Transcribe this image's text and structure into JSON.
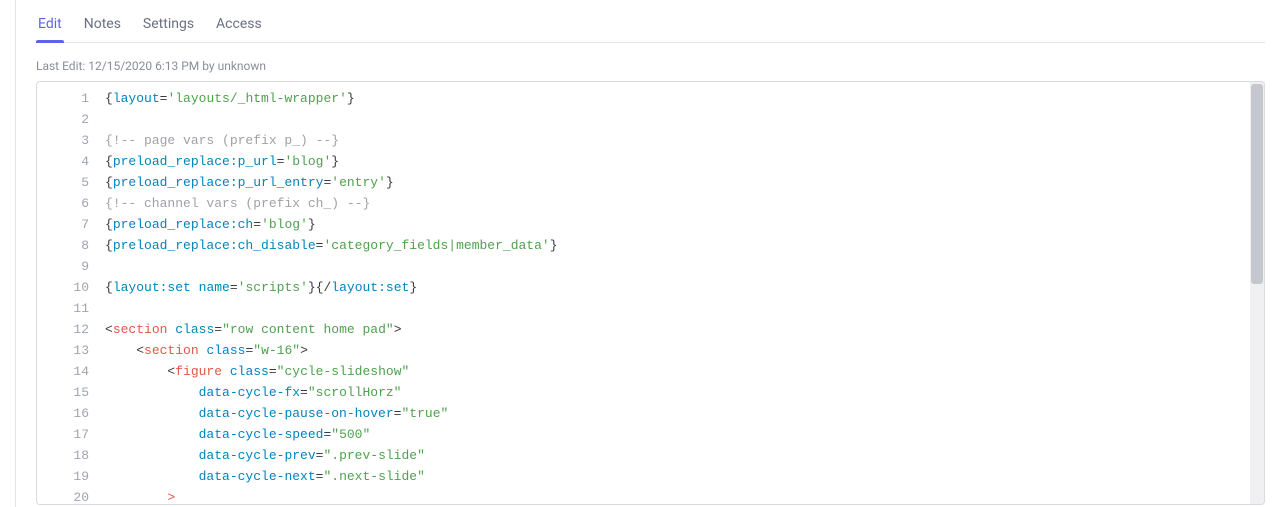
{
  "tabs": {
    "edit": "Edit",
    "notes": "Notes",
    "settings": "Settings",
    "access": "Access"
  },
  "meta": {
    "last_edit_label": "Last Edit: 12/15/2020 6:13 PM by unknown"
  },
  "editor": {
    "line_count": 20,
    "code_lines": [
      [
        {
          "c": "p",
          "t": "{"
        },
        {
          "c": "kw",
          "t": "layout"
        },
        {
          "c": "p",
          "t": "="
        },
        {
          "c": "str",
          "t": "'layouts/_html-wrapper'"
        },
        {
          "c": "p",
          "t": "}"
        }
      ],
      [],
      [
        {
          "c": "cmt",
          "t": "{!-- page vars (prefix p_) --}"
        }
      ],
      [
        {
          "c": "p",
          "t": "{"
        },
        {
          "c": "kw",
          "t": "preload_replace:p_url"
        },
        {
          "c": "p",
          "t": "="
        },
        {
          "c": "str",
          "t": "'blog'"
        },
        {
          "c": "p",
          "t": "}"
        }
      ],
      [
        {
          "c": "p",
          "t": "{"
        },
        {
          "c": "kw",
          "t": "preload_replace:p_url_entry"
        },
        {
          "c": "p",
          "t": "="
        },
        {
          "c": "str",
          "t": "'entry'"
        },
        {
          "c": "p",
          "t": "}"
        }
      ],
      [
        {
          "c": "cmt",
          "t": "{!-- channel vars (prefix ch_) --}"
        }
      ],
      [
        {
          "c": "p",
          "t": "{"
        },
        {
          "c": "kw",
          "t": "preload_replace:ch"
        },
        {
          "c": "p",
          "t": "="
        },
        {
          "c": "str",
          "t": "'blog'"
        },
        {
          "c": "p",
          "t": "}"
        }
      ],
      [
        {
          "c": "p",
          "t": "{"
        },
        {
          "c": "kw",
          "t": "preload_replace:ch_disable"
        },
        {
          "c": "p",
          "t": "="
        },
        {
          "c": "str",
          "t": "'category_fields|member_data'"
        },
        {
          "c": "p",
          "t": "}"
        }
      ],
      [],
      [
        {
          "c": "p",
          "t": "{"
        },
        {
          "c": "kw",
          "t": "layout:set"
        },
        {
          "c": "p",
          "t": " "
        },
        {
          "c": "kw",
          "t": "name"
        },
        {
          "c": "p",
          "t": "="
        },
        {
          "c": "str",
          "t": "'scripts'"
        },
        {
          "c": "p",
          "t": "}{/"
        },
        {
          "c": "kw",
          "t": "layout:set"
        },
        {
          "c": "p",
          "t": "}"
        }
      ],
      [],
      [
        {
          "c": "p",
          "t": "<"
        },
        {
          "c": "tag",
          "t": "section"
        },
        {
          "c": "p",
          "t": " "
        },
        {
          "c": "kw",
          "t": "class"
        },
        {
          "c": "p",
          "t": "="
        },
        {
          "c": "str",
          "t": "\"row content home pad\""
        },
        {
          "c": "p",
          "t": ">"
        }
      ],
      [
        {
          "c": "p",
          "t": "    <"
        },
        {
          "c": "tag",
          "t": "section"
        },
        {
          "c": "p",
          "t": " "
        },
        {
          "c": "kw",
          "t": "class"
        },
        {
          "c": "p",
          "t": "="
        },
        {
          "c": "str",
          "t": "\"w-16\""
        },
        {
          "c": "p",
          "t": ">"
        }
      ],
      [
        {
          "c": "p",
          "t": "        <"
        },
        {
          "c": "tag",
          "t": "figure"
        },
        {
          "c": "p",
          "t": " "
        },
        {
          "c": "kw",
          "t": "class"
        },
        {
          "c": "p",
          "t": "="
        },
        {
          "c": "str",
          "t": "\"cycle-slideshow\""
        }
      ],
      [
        {
          "c": "p",
          "t": "            "
        },
        {
          "c": "kw",
          "t": "data-cycle-fx"
        },
        {
          "c": "p",
          "t": "="
        },
        {
          "c": "str",
          "t": "\"scrollHorz\""
        }
      ],
      [
        {
          "c": "p",
          "t": "            "
        },
        {
          "c": "kw",
          "t": "data-cycle-pause-on-hover"
        },
        {
          "c": "p",
          "t": "="
        },
        {
          "c": "str",
          "t": "\"true\""
        }
      ],
      [
        {
          "c": "p",
          "t": "            "
        },
        {
          "c": "kw",
          "t": "data-cycle-speed"
        },
        {
          "c": "p",
          "t": "="
        },
        {
          "c": "str",
          "t": "\"500\""
        }
      ],
      [
        {
          "c": "p",
          "t": "            "
        },
        {
          "c": "kw",
          "t": "data-cycle-prev"
        },
        {
          "c": "p",
          "t": "="
        },
        {
          "c": "str",
          "t": "\".prev-slide\""
        }
      ],
      [
        {
          "c": "p",
          "t": "            "
        },
        {
          "c": "kw",
          "t": "data-cycle-next"
        },
        {
          "c": "p",
          "t": "="
        },
        {
          "c": "str",
          "t": "\".next-slide\""
        }
      ],
      [
        {
          "c": "p",
          "t": "        "
        },
        {
          "c": "tag",
          "t": ">"
        }
      ]
    ]
  }
}
